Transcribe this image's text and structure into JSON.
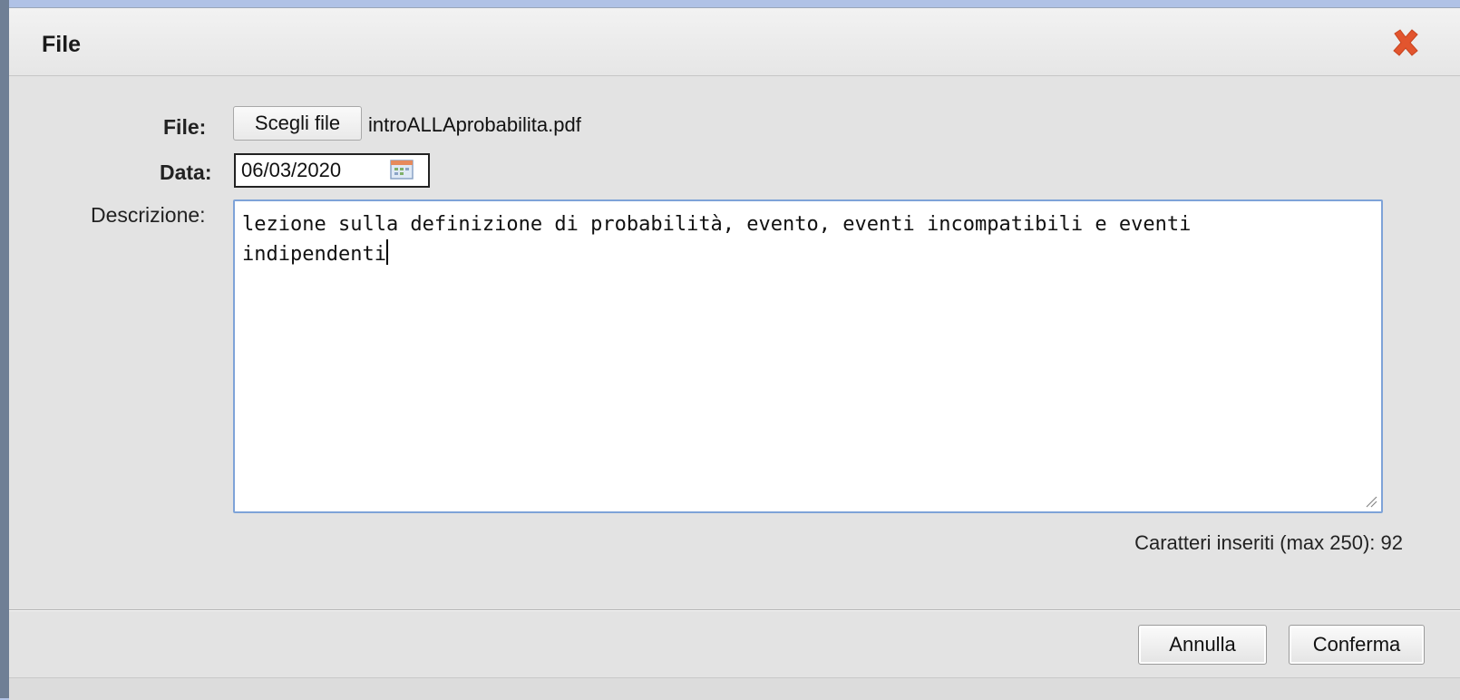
{
  "dialog": {
    "title": "File",
    "close_icon": "close-x-icon",
    "accent_close": "#e2552e"
  },
  "form": {
    "file_label": "File:",
    "choose_button": "Scegli file",
    "file_name": "introALLAprobabilita.pdf",
    "date_label": "Data:",
    "date_value": "06/03/2020",
    "calendar_icon": "calendar-icon",
    "description_label": "Descrizione:",
    "description_value": "lezione sulla definizione di probabilità, evento, eventi incompatibili e eventi\nindipendenti",
    "char_count": "Caratteri inseriti (max 250): 92"
  },
  "footer": {
    "cancel": "Annulla",
    "confirm": "Conferma"
  }
}
